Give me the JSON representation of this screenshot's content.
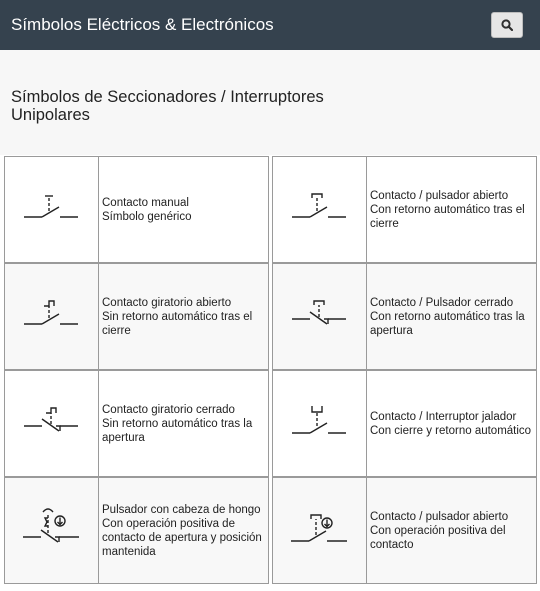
{
  "header": {
    "title": "Símbolos Eléctricos & Electrónicos",
    "search_icon": "search-icon"
  },
  "section": {
    "title": "Símbolos de Seccionadores / Interruptores\nUnipolares"
  },
  "cells": [
    {
      "icon": "manual-contact-symbol",
      "text": "Contacto manual\nSímbolo genérico"
    },
    {
      "icon": "push-button-open-symbol",
      "text": "Contacto / pulsador abierto\nCon retorno automático tras el cierre"
    },
    {
      "icon": "rotary-contact-open-symbol",
      "text": "Contacto giratorio abierto\nSin retorno automático tras el cierre"
    },
    {
      "icon": "push-button-closed-symbol",
      "text": "Contacto / Pulsador cerrado\nCon retorno automático tras la apertura"
    },
    {
      "icon": "rotary-contact-closed-symbol",
      "text": "Contacto giratorio cerrado\nSin retorno automático tras la apertura"
    },
    {
      "icon": "pull-switch-symbol",
      "text": "Contacto / Interruptor jalador\nCon cierre y retorno automático"
    },
    {
      "icon": "mushroom-head-button-symbol",
      "text": "Pulsador con cabeza de hongo\nCon operación positiva de contacto de apertura y posición mantenida"
    },
    {
      "icon": "positive-operation-push-button-symbol",
      "text": "Contacto / pulsador abierto\nCon operación positiva del contacto"
    }
  ]
}
